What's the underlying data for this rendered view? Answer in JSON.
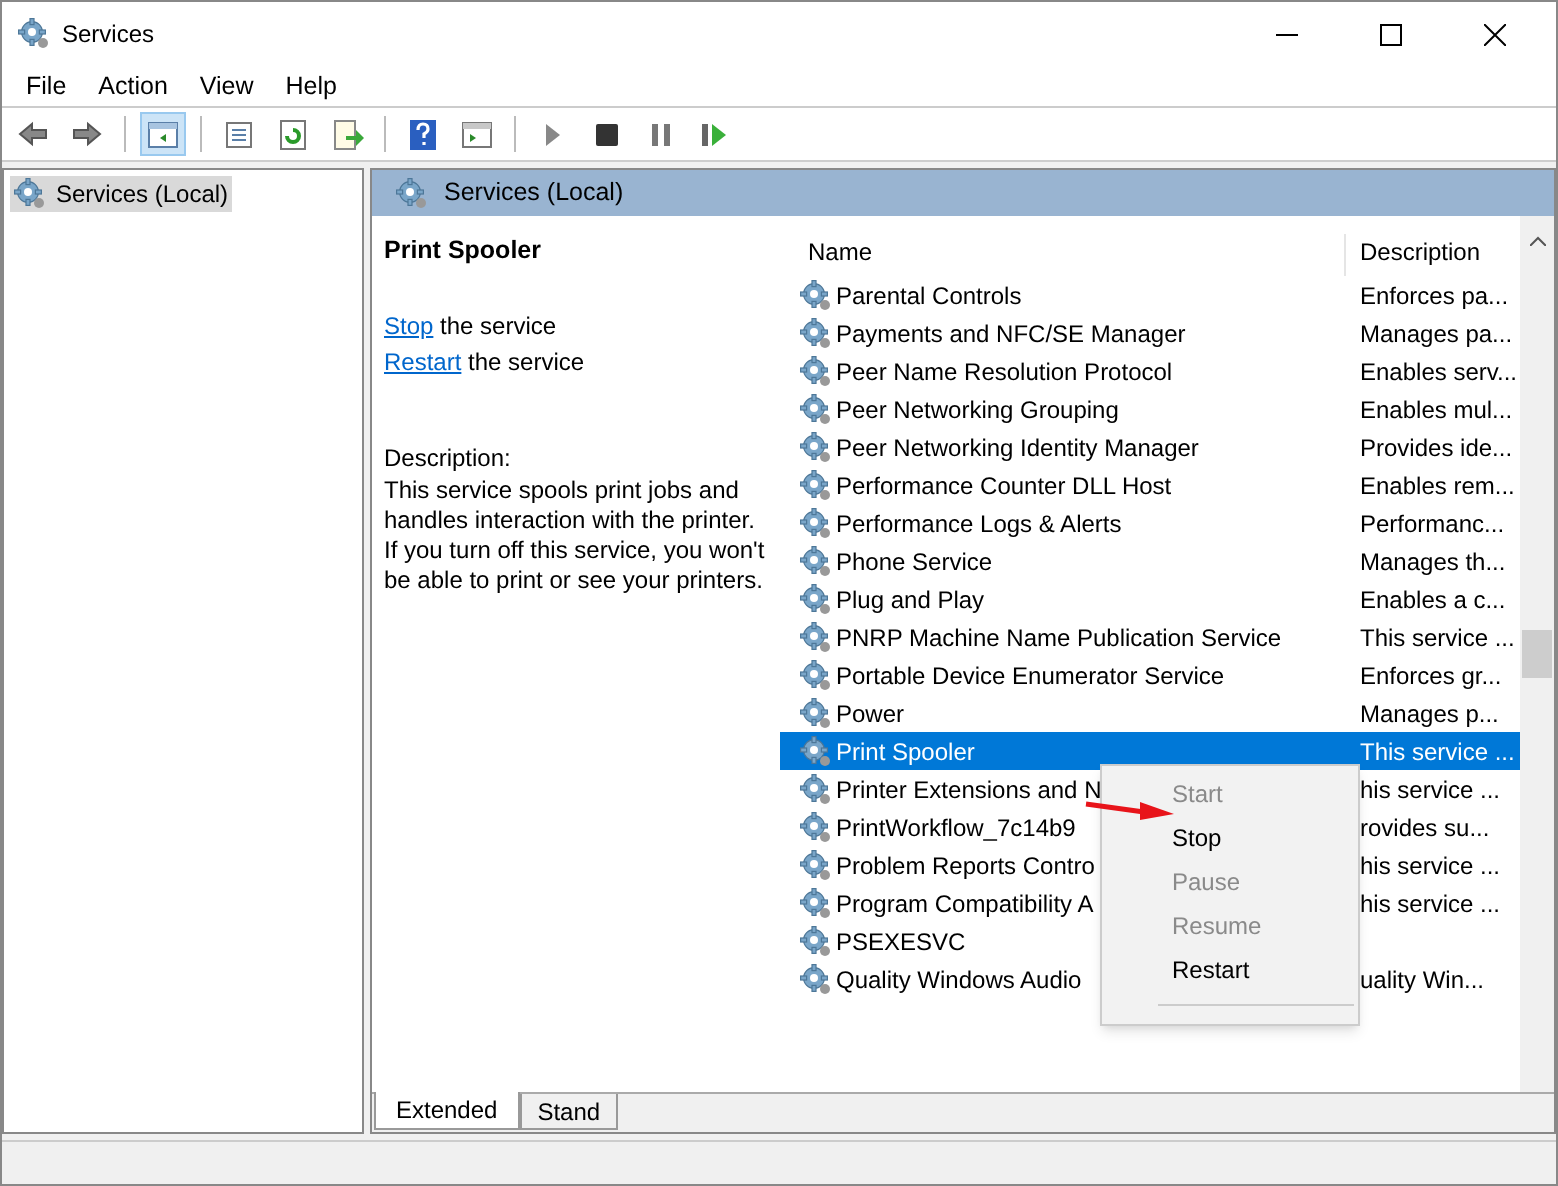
{
  "window": {
    "title": "Services"
  },
  "menu": [
    "File",
    "Action",
    "View",
    "Help"
  ],
  "toolbar": [
    [
      {
        "kind": "back",
        "selected": false
      },
      {
        "kind": "forward",
        "selected": false
      }
    ],
    [
      {
        "kind": "tree",
        "selected": true
      }
    ],
    [
      {
        "kind": "properties",
        "selected": false
      },
      {
        "kind": "refresh",
        "selected": false
      },
      {
        "kind": "export",
        "selected": false
      }
    ],
    [
      {
        "kind": "help",
        "selected": false
      },
      {
        "kind": "pane",
        "selected": false
      }
    ],
    [
      {
        "kind": "play",
        "selected": false
      },
      {
        "kind": "stop",
        "selected": false
      },
      {
        "kind": "pause",
        "selected": false
      },
      {
        "kind": "resume",
        "selected": false
      }
    ]
  ],
  "tree": {
    "label": "Services (Local)",
    "selected": true
  },
  "panel": {
    "header": "Services (Local)",
    "service_name": "Print Spooler",
    "actions": [
      {
        "link": "Stop",
        "text": "the service"
      },
      {
        "link": "Restart",
        "text": "the service"
      }
    ],
    "description_label": "Description:",
    "description": "This service spools print jobs and handles interaction with the printer. If you turn off this service, you won't be able to print or see your printers."
  },
  "table": {
    "columns": [
      "Name",
      "Description"
    ],
    "rows": [
      {
        "name": "Parental Controls",
        "description": "Enforces pa...",
        "selected": false
      },
      {
        "name": "Payments and NFC/SE Manager",
        "description": "Manages pa...",
        "selected": false
      },
      {
        "name": "Peer Name Resolution Protocol",
        "description": "Enables serv...",
        "selected": false
      },
      {
        "name": "Peer Networking Grouping",
        "description": "Enables mul...",
        "selected": false
      },
      {
        "name": "Peer Networking Identity Manager",
        "description": "Provides ide...",
        "selected": false
      },
      {
        "name": "Performance Counter DLL Host",
        "description": "Enables rem...",
        "selected": false
      },
      {
        "name": "Performance Logs & Alerts",
        "description": "Performanc...",
        "selected": false
      },
      {
        "name": "Phone Service",
        "description": "Manages th...",
        "selected": false
      },
      {
        "name": "Plug and Play",
        "description": "Enables a c...",
        "selected": false
      },
      {
        "name": "PNRP Machine Name Publication Service",
        "description": "This service ...",
        "selected": false
      },
      {
        "name": "Portable Device Enumerator Service",
        "description": "Enforces gr...",
        "selected": false
      },
      {
        "name": "Power",
        "description": "Manages p...",
        "selected": false
      },
      {
        "name": "Print Spooler",
        "description": "This service ...",
        "selected": true
      },
      {
        "name": "Printer Extensions and N",
        "description": "his service ...",
        "selected": false
      },
      {
        "name": "PrintWorkflow_7c14b9",
        "description": "rovides su...",
        "selected": false
      },
      {
        "name": "Problem Reports Contro",
        "description": "his service ...",
        "selected": false
      },
      {
        "name": "Program Compatibility A",
        "description": "his service ...",
        "selected": false
      },
      {
        "name": "PSEXESVC",
        "selected": false
      },
      {
        "name": "Quality Windows Audio",
        "description": "uality Win...",
        "selected": false
      }
    ]
  },
  "context_menu": [
    {
      "label": "Start",
      "disabled": true
    },
    {
      "label": "Stop",
      "disabled": false
    },
    {
      "label": "Pause",
      "disabled": true
    },
    {
      "label": "Resume",
      "disabled": true
    },
    {
      "label": "Restart",
      "disabled": false
    }
  ],
  "view_tabs": [
    {
      "label": "Extended",
      "selected": true
    },
    {
      "label": "Stand",
      "selected": false
    }
  ]
}
